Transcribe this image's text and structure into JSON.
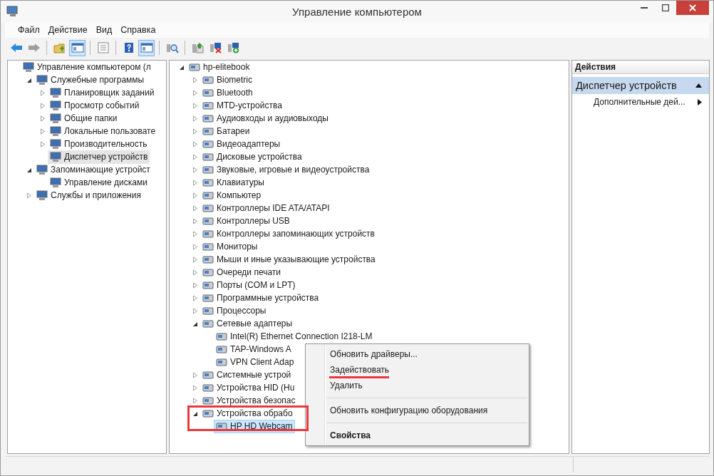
{
  "window": {
    "title": "Управление компьютером"
  },
  "menu_bar": [
    "Файл",
    "Действие",
    "Вид",
    "Справка"
  ],
  "toolbar": [
    {
      "on": false,
      "disabled": false,
      "separator_before": false
    },
    {
      "on": false,
      "disabled": true,
      "separator_before": false
    },
    {
      "on": false,
      "disabled": false,
      "separator_before": true
    },
    {
      "on": true,
      "disabled": false,
      "separator_before": false
    },
    {
      "on": false,
      "disabled": false,
      "separator_before": true
    },
    {
      "on": false,
      "disabled": false,
      "separator_before": true
    },
    {
      "on": true,
      "disabled": false,
      "separator_before": false
    },
    {
      "on": false,
      "disabled": false,
      "separator_before": true
    },
    {
      "on": false,
      "disabled": false,
      "separator_before": true
    },
    {
      "on": false,
      "disabled": false,
      "separator_before": false
    },
    {
      "on": false,
      "disabled": false,
      "separator_before": false
    }
  ],
  "console_tree": {
    "label": "Управление компьютером (л",
    "selected": false,
    "children": [
      {
        "label": "Служебные программы",
        "expanded": true,
        "selected": false,
        "children": [
          {
            "label": "Планировщик заданий",
            "expanded": false,
            "selected": false
          },
          {
            "label": "Просмотр событий",
            "expanded": false,
            "selected": false
          },
          {
            "label": "Общие папки",
            "expanded": false,
            "selected": false
          },
          {
            "label": "Локальные пользовате",
            "expanded": false,
            "selected": false
          },
          {
            "label": "Производительность",
            "expanded": false,
            "selected": false
          },
          {
            "label": "Диспетчер устройств",
            "selected": true
          }
        ]
      },
      {
        "label": "Запоминающие устройст",
        "expanded": true,
        "selected": false,
        "children": [
          {
            "label": "Управление дисками",
            "selected": false
          }
        ]
      },
      {
        "label": "Службы и приложения",
        "expanded": false,
        "selected": false
      }
    ]
  },
  "device_tree": {
    "label": "hp-elitebook",
    "expanded": true,
    "selected": false,
    "children": [
      {
        "label": "Biometric",
        "expanded": false,
        "selected": false
      },
      {
        "label": "Bluetooth",
        "expanded": false,
        "selected": false
      },
      {
        "label": "MTD-устройства",
        "expanded": false,
        "selected": false
      },
      {
        "label": "Аудиовходы и аудиовыходы",
        "expanded": false,
        "selected": false
      },
      {
        "label": "Батареи",
        "expanded": false,
        "selected": false
      },
      {
        "label": "Видеоадаптеры",
        "expanded": false,
        "selected": false
      },
      {
        "label": "Дисковые устройства",
        "expanded": false,
        "selected": false
      },
      {
        "label": "Звуковые, игровые и видеоустройства",
        "expanded": false,
        "selected": false
      },
      {
        "label": "Клавиатуры",
        "expanded": false,
        "selected": false
      },
      {
        "label": "Компьютер",
        "expanded": false,
        "selected": false
      },
      {
        "label": "Контроллеры IDE ATA/ATAPI",
        "expanded": false,
        "selected": false
      },
      {
        "label": "Контроллеры USB",
        "expanded": false,
        "selected": false
      },
      {
        "label": "Контроллеры запоминающих устройств",
        "expanded": false,
        "selected": false
      },
      {
        "label": "Мониторы",
        "expanded": false,
        "selected": false
      },
      {
        "label": "Мыши и иные указывающие устройства",
        "expanded": false,
        "selected": false
      },
      {
        "label": "Очереди печати",
        "expanded": false,
        "selected": false
      },
      {
        "label": "Порты (COM и LPT)",
        "expanded": false,
        "selected": false
      },
      {
        "label": "Программные устройства",
        "expanded": false,
        "selected": false
      },
      {
        "label": "Процессоры",
        "expanded": false,
        "selected": false
      },
      {
        "label": "Сетевые адаптеры",
        "expanded": true,
        "selected": false,
        "children": [
          {
            "label": "Intel(R) Ethernet Connection I218-LM",
            "selected": false
          },
          {
            "label": "TAP-Windows A",
            "selected": false
          },
          {
            "label": "VPN Client Adap",
            "selected": false
          }
        ]
      },
      {
        "label": "Системные устрой",
        "expanded": false,
        "selected": false
      },
      {
        "label": "Устройства HID (Hu",
        "expanded": false,
        "selected": false
      },
      {
        "label": "Устройства безопас",
        "expanded": false,
        "selected": false
      },
      {
        "label": "Устройства обрабо",
        "expanded": true,
        "selected": false,
        "highlighted": true,
        "children": [
          {
            "label": "HP HD Webcam",
            "selected": true
          }
        ]
      }
    ]
  },
  "context_menu": {
    "items": [
      {
        "label": "Обновить драйверы...",
        "separator_before": false,
        "default": false,
        "underlined": false
      },
      {
        "label": "Задействовать",
        "separator_before": false,
        "default": false,
        "underlined": true
      },
      {
        "label": "Удалить",
        "separator_before": false,
        "default": false,
        "underlined": false
      },
      {
        "label": "Обновить конфигурацию оборудования",
        "separator_before": true,
        "default": false,
        "underlined": false
      },
      {
        "label": "Свойства",
        "separator_before": true,
        "default": true,
        "underlined": false
      }
    ]
  },
  "actions_pane": {
    "title": "Действия",
    "sections": [
      {
        "label": "Диспетчер устройств",
        "expanded": true,
        "items": [
          {
            "label": "Дополнительные дей...",
            "submenu": true
          }
        ]
      }
    ]
  }
}
